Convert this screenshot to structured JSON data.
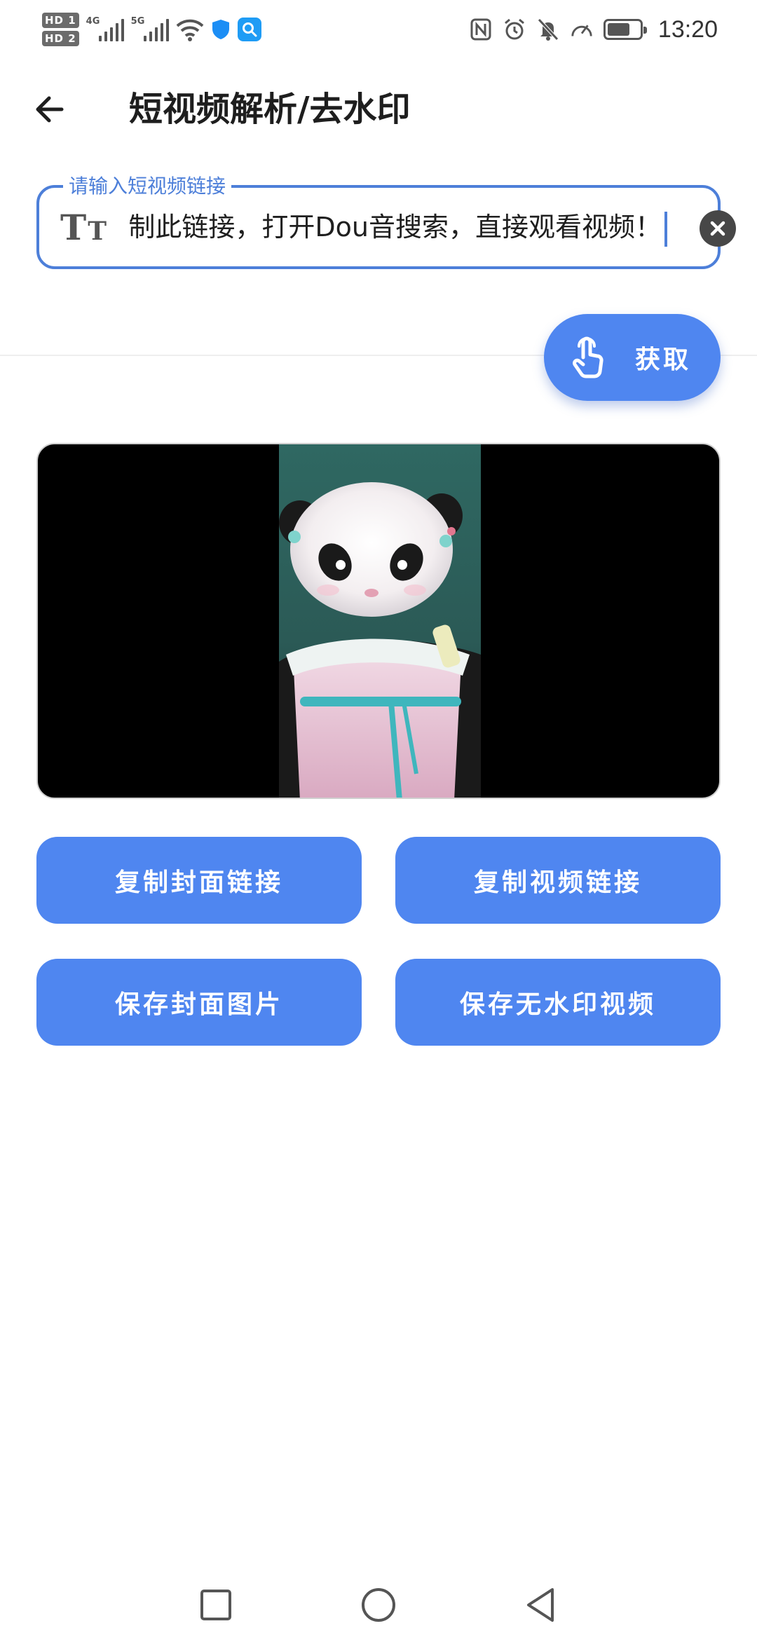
{
  "status_bar": {
    "hd1": "HD 1",
    "hd2": "HD 2",
    "sim1_network": "4G",
    "sim2_network": "5G",
    "time": "13:20"
  },
  "app_bar": {
    "title": "短视频解析/去水印"
  },
  "link_input": {
    "label": "请输入短视频链接",
    "value": "复制此链接，打开Dou音搜索，直接观看视频！"
  },
  "fetch_button": {
    "label": "获取"
  },
  "actions": {
    "copy_cover_link": "复制封面链接",
    "copy_video_link": "复制视频链接",
    "save_cover_image": "保存封面图片",
    "save_video_no_watermark": "保存无水印视频"
  },
  "colors": {
    "accent": "#4F86F0",
    "input_border": "#4D7FD9",
    "video_background": "#000000"
  },
  "icons": {
    "back": "arrow-left-icon",
    "text_format": "text-format-icon",
    "clear": "clear-circle-icon",
    "fetch": "tap-hand-icon",
    "nav_recents": "square-icon",
    "nav_home": "circle-icon",
    "nav_back": "triangle-back-icon"
  }
}
